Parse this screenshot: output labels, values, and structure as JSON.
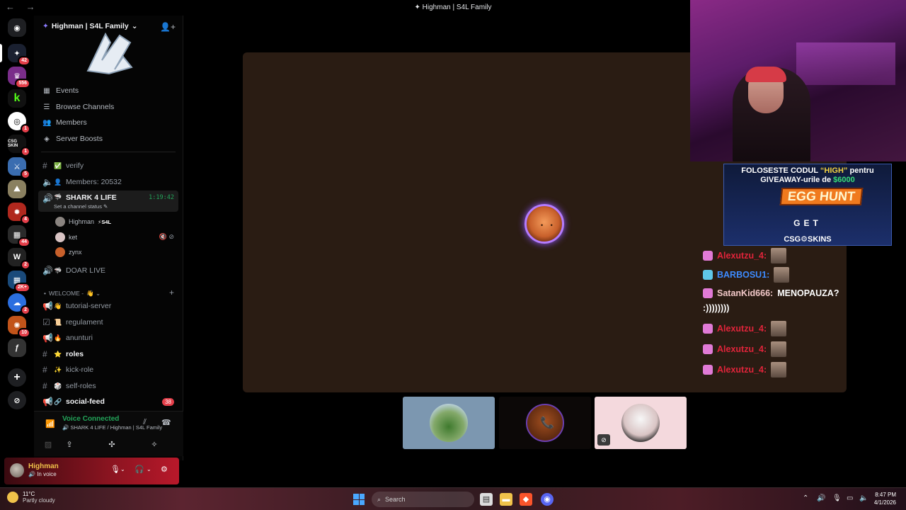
{
  "window": {
    "title": "Highman | S4L Family"
  },
  "rail": {
    "servers": [
      {
        "badge": ""
      },
      {
        "badge": "42"
      },
      {
        "badge": "556"
      },
      {
        "badge": ""
      },
      {
        "badge": "1"
      },
      {
        "badge": "1"
      },
      {
        "badge": "5"
      },
      {
        "badge": ""
      },
      {
        "badge": "4"
      },
      {
        "badge": "44"
      },
      {
        "badge": "2"
      },
      {
        "badge": "2K+"
      },
      {
        "badge": "2"
      },
      {
        "badge": "10"
      },
      {
        "badge": ""
      }
    ],
    "csg_label": "CSG SKIN"
  },
  "server": {
    "name": "Highman | S4L Family",
    "menu": [
      "Events",
      "Browse Channels",
      "Members",
      "Server Boosts"
    ]
  },
  "channels": {
    "verify": "verify",
    "members": "Members: 20532",
    "voice_active": {
      "name": "SHARK 4 LIFE",
      "timer": "1:19:42",
      "status": "Set a channel status"
    },
    "voice_users": [
      {
        "name": "Highman",
        "tag": "S4L"
      },
      {
        "name": "ket",
        "tag": ""
      },
      {
        "name": "zynx",
        "tag": ""
      }
    ],
    "doar_live": "DOAR LIVE",
    "category": "WELCOME -",
    "list": [
      {
        "name": "tutorial-server",
        "bold": false
      },
      {
        "name": "regulament",
        "bold": false
      },
      {
        "name": "anunturi",
        "bold": false
      },
      {
        "name": "roles",
        "bold": true
      },
      {
        "name": "kick-role",
        "bold": false
      },
      {
        "name": "self-roles",
        "bold": false
      },
      {
        "name": "social-feed",
        "bold": true,
        "mention": "38"
      }
    ]
  },
  "voice": {
    "title": "Voice Connected",
    "subtitle": "SHARK 4 LIFE / Highman | S4L Family"
  },
  "user": {
    "name": "Highman",
    "status": "In voice"
  },
  "overlay": {
    "promo_line1_a": "FOLOSESTE CODUL ",
    "promo_code": "“HIGH”",
    "promo_line1_b": " pentru",
    "promo_line2_a": "GIVEAWAY-urile de ",
    "promo_amount": "$6000",
    "promo_event": "EGG HUNT",
    "promo_get": "GET",
    "promo_brand": "CSG⚙SKINS"
  },
  "chat": [
    {
      "user": "Alexutzu_4:",
      "color": "#e0243a",
      "msg": "",
      "emote": true
    },
    {
      "user": "BARBOSU1:",
      "color": "#3d8bff",
      "msg": "",
      "emote": true
    },
    {
      "user": "SatanKid666:",
      "color": "#f2c8c8",
      "msg": "MENOPAUZA?",
      "emote": false
    },
    {
      "user": "",
      "color": "#ffffff",
      "msg": ":))))))))",
      "emote": false
    },
    {
      "user": "Alexutzu_4:",
      "color": "#e0243a",
      "msg": "",
      "emote": true
    },
    {
      "user": "Alexutzu_4:",
      "color": "#e0243a",
      "msg": "",
      "emote": true
    },
    {
      "user": "Alexutzu_4:",
      "color": "#e0243a",
      "msg": "",
      "emote": true
    }
  ],
  "taskbar": {
    "temp": "11°C",
    "weather": "Partly cloudy",
    "search": "Search",
    "time": "8:47 PM",
    "date": "4/1/2026"
  }
}
